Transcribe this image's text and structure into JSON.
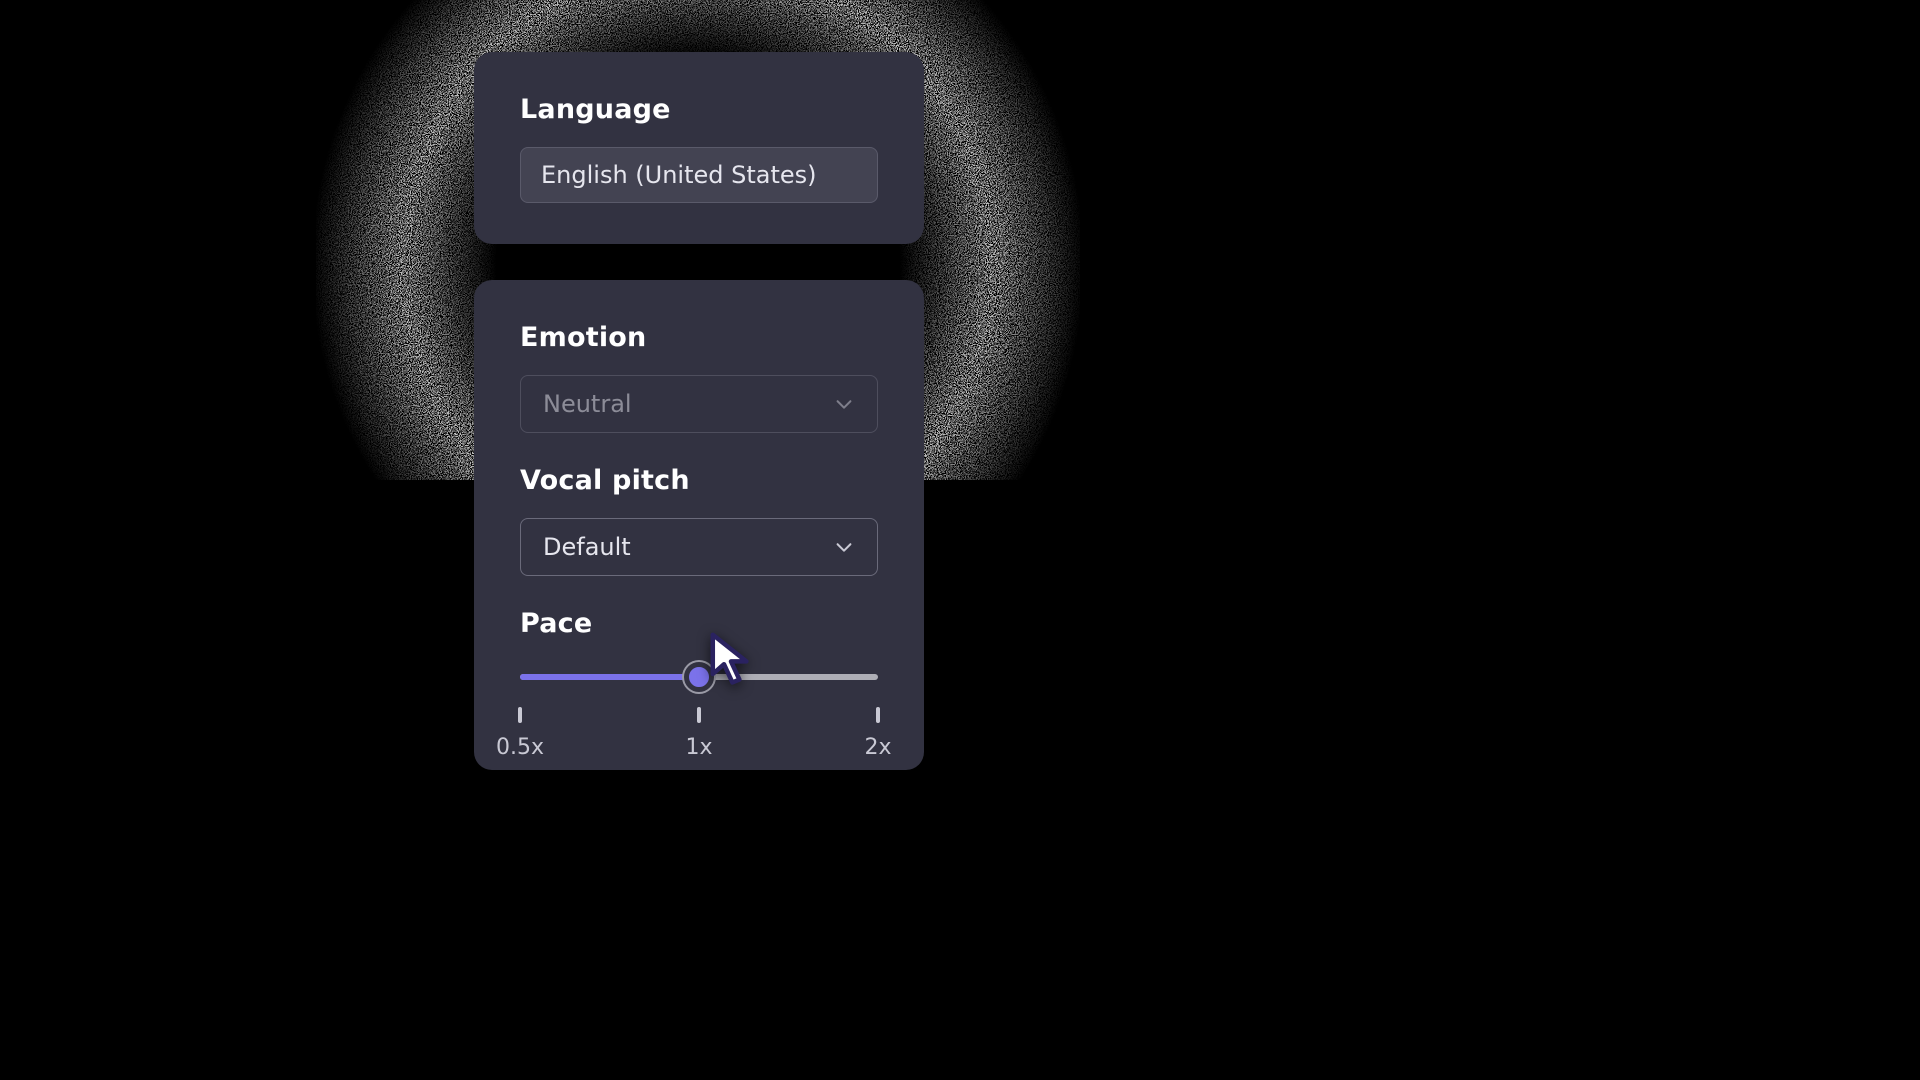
{
  "language": {
    "label": "Language",
    "value": "English (United States)"
  },
  "emotion": {
    "label": "Emotion",
    "value": "Neutral",
    "enabled": false
  },
  "vocal_pitch": {
    "label": "Vocal pitch",
    "value": "Default",
    "enabled": true
  },
  "pace": {
    "label": "Pace",
    "min": 0.5,
    "max": 2.0,
    "value": 1.0,
    "fill_percent": 50,
    "marks": [
      {
        "value": 0.5,
        "label": "0.5x",
        "percent": 0
      },
      {
        "value": 1.0,
        "label": "1x",
        "percent": 50
      },
      {
        "value": 2.0,
        "label": "2x",
        "percent": 100
      }
    ]
  },
  "colors": {
    "panel_bg": "#323241",
    "accent": "#7b72ea",
    "track": "#aeaeb6",
    "text": "#ffffff",
    "muted": "#c9c9d4"
  }
}
